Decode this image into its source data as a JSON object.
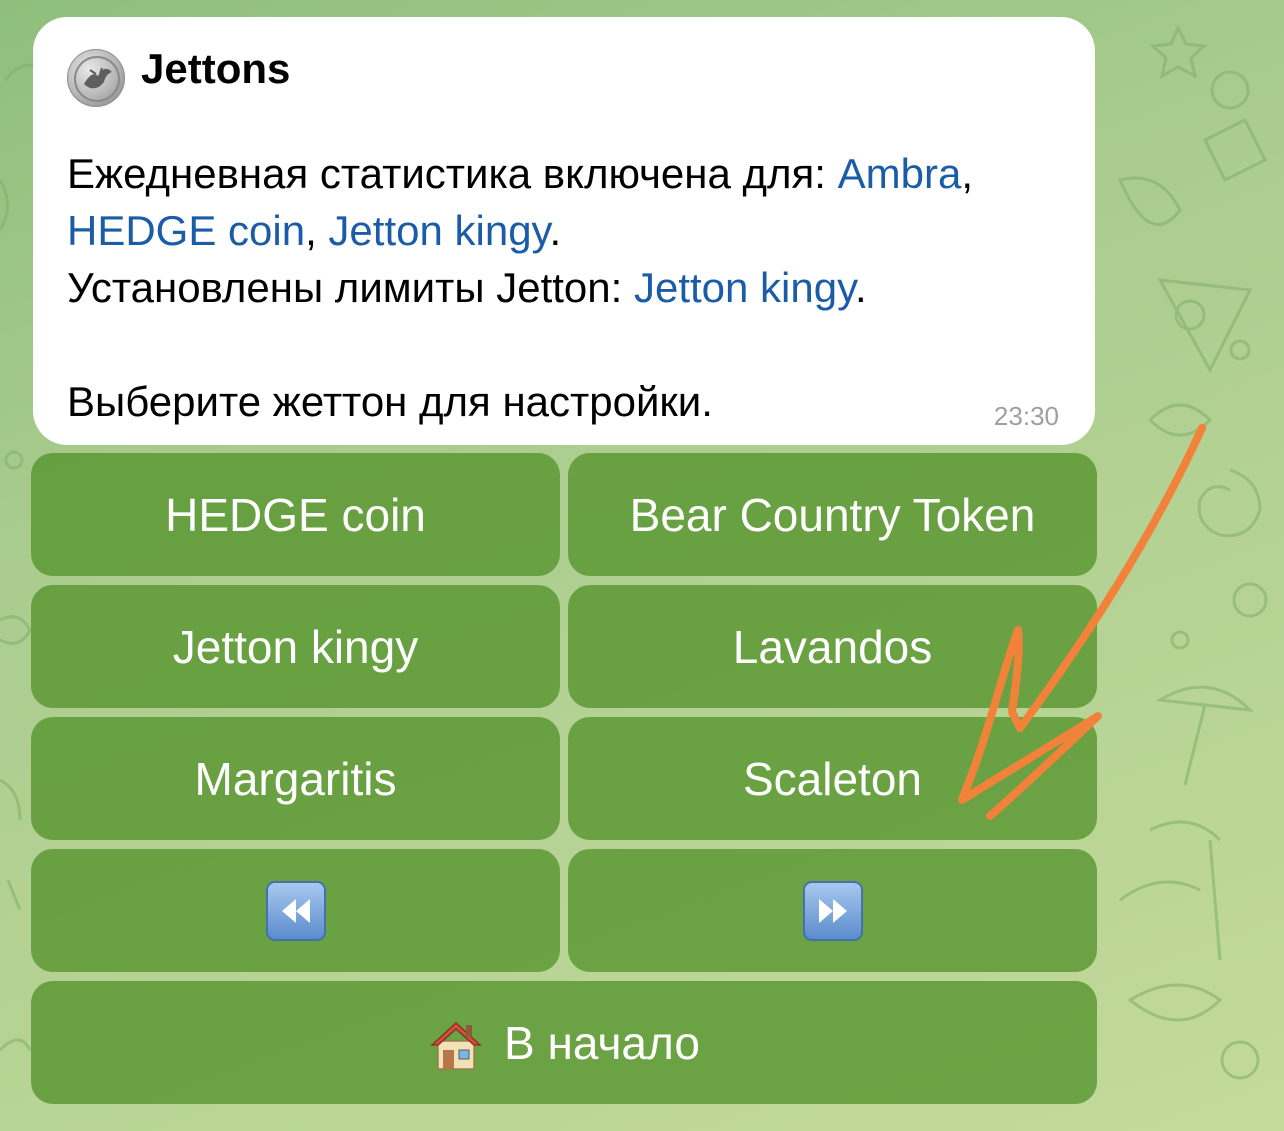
{
  "message": {
    "sender": "Jettons",
    "line1_prefix": "Ежедневная статистика включена для: ",
    "line1_link": "Ambra",
    "comma": ",",
    "line2_link1": "HEDGE coin",
    "line2_sep": ", ",
    "line2_link2": "Jetton kingy",
    "period": ".",
    "line3_prefix": "Установлены лимиты Jetton: ",
    "line3_link": "Jetton kingy",
    "line4": "Выберите жеттон для настройки.",
    "time": "23:30"
  },
  "keyboard": {
    "row1": [
      "HEDGE coin",
      "Bear Country Token"
    ],
    "row2": [
      "Jetton kingy",
      "Lavandos"
    ],
    "row3": [
      "Margaritis",
      "Scaleton"
    ],
    "prev_icon": "rewind-icon",
    "next_icon": "fast-forward-icon",
    "home_icon": "house-icon",
    "home_label": "В начало"
  },
  "colors": {
    "link": "#1a5ca7",
    "button_bg": "#6aa443",
    "annotation": "#f2823a"
  }
}
